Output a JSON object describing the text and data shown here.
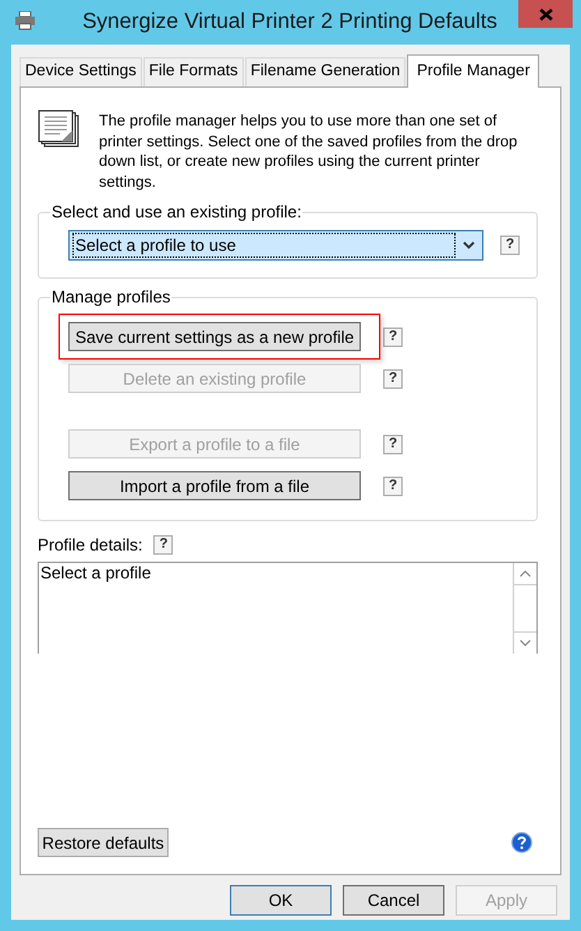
{
  "window": {
    "title": "Synergize Virtual Printer 2 Printing Defaults"
  },
  "tabs": [
    {
      "label": "Device Settings",
      "selected": false
    },
    {
      "label": "File Formats",
      "selected": false
    },
    {
      "label": "Filename Generation",
      "selected": false
    },
    {
      "label": "Profile Manager",
      "selected": true
    }
  ],
  "intro": "The profile manager helps you to use more than one set of printer settings. Select one of the saved profiles from the drop down list, or create new profiles using the current printer settings.",
  "select_group": {
    "legend": "Select and use an existing profile:",
    "dropdown": {
      "value": "Select a profile to use",
      "focused": true
    },
    "help": "?"
  },
  "manage_group": {
    "legend": "Manage profiles",
    "buttons": [
      {
        "label": "Save current settings as a new profile",
        "disabled": false,
        "highlighted": true,
        "help": "?"
      },
      {
        "label": "Delete an existing profile",
        "disabled": true,
        "highlighted": false,
        "help": "?"
      },
      {
        "label": "Export a profile to a file",
        "disabled": true,
        "highlighted": false,
        "help": "?"
      },
      {
        "label": "Import a profile from a file",
        "disabled": false,
        "highlighted": false,
        "help": "?"
      }
    ]
  },
  "details": {
    "label": "Profile details:",
    "help": "?",
    "value": "Select a profile"
  },
  "restore_button": "Restore defaults",
  "dialog_buttons": [
    {
      "label": "OK",
      "disabled": false,
      "default": true
    },
    {
      "label": "Cancel",
      "disabled": false,
      "default": false
    },
    {
      "label": "Apply",
      "disabled": true,
      "default": false
    }
  ]
}
